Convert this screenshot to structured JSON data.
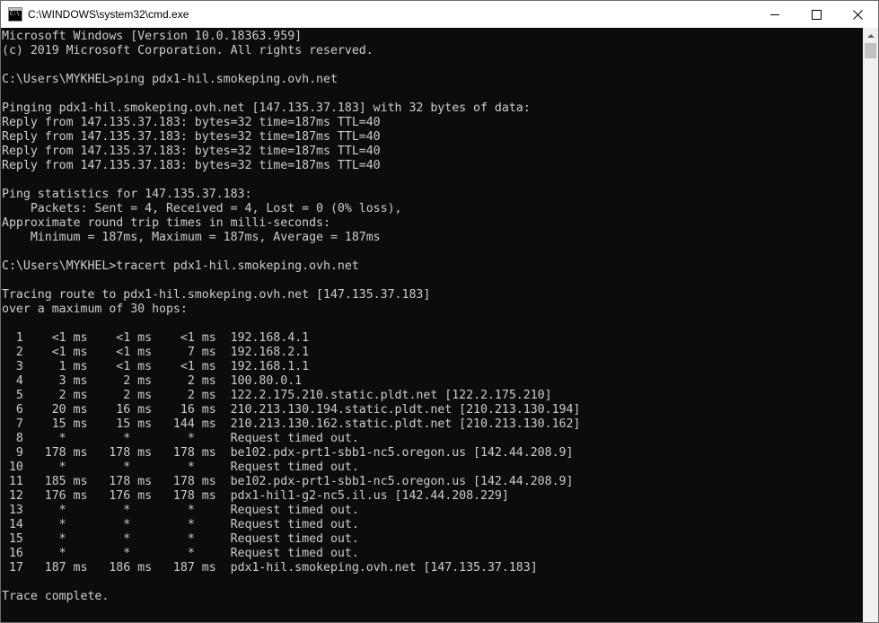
{
  "window": {
    "title": "C:\\WINDOWS\\system32\\cmd.exe",
    "icon": "console-app-icon"
  },
  "controls": {
    "minimize": "minimize-icon",
    "maximize": "maximize-icon",
    "close": "close-icon"
  },
  "console": {
    "lines": [
      "Microsoft Windows [Version 10.0.18363.959]",
      "(c) 2019 Microsoft Corporation. All rights reserved.",
      "",
      "C:\\Users\\MYKHEL>ping pdx1-hil.smokeping.ovh.net",
      "",
      "Pinging pdx1-hil.smokeping.ovh.net [147.135.37.183] with 32 bytes of data:",
      "Reply from 147.135.37.183: bytes=32 time=187ms TTL=40",
      "Reply from 147.135.37.183: bytes=32 time=187ms TTL=40",
      "Reply from 147.135.37.183: bytes=32 time=187ms TTL=40",
      "Reply from 147.135.37.183: bytes=32 time=187ms TTL=40",
      "",
      "Ping statistics for 147.135.37.183:",
      "    Packets: Sent = 4, Received = 4, Lost = 0 (0% loss),",
      "Approximate round trip times in milli-seconds:",
      "    Minimum = 187ms, Maximum = 187ms, Average = 187ms",
      "",
      "C:\\Users\\MYKHEL>tracert pdx1-hil.smokeping.ovh.net",
      "",
      "Tracing route to pdx1-hil.smokeping.ovh.net [147.135.37.183]",
      "over a maximum of 30 hops:",
      "",
      "  1    <1 ms    <1 ms    <1 ms  192.168.4.1",
      "  2    <1 ms    <1 ms     7 ms  192.168.2.1",
      "  3     1 ms    <1 ms    <1 ms  192.168.1.1",
      "  4     3 ms     2 ms     2 ms  100.80.0.1",
      "  5     2 ms     2 ms     2 ms  122.2.175.210.static.pldt.net [122.2.175.210]",
      "  6    20 ms    16 ms    16 ms  210.213.130.194.static.pldt.net [210.213.130.194]",
      "  7    15 ms    15 ms   144 ms  210.213.130.162.static.pldt.net [210.213.130.162]",
      "  8     *        *        *     Request timed out.",
      "  9   178 ms   178 ms   178 ms  be102.pdx-prt1-sbb1-nc5.oregon.us [142.44.208.9]",
      " 10     *        *        *     Request timed out.",
      " 11   185 ms   178 ms   178 ms  be102.pdx-prt1-sbb1-nc5.oregon.us [142.44.208.9]",
      " 12   176 ms   176 ms   178 ms  pdx1-hil1-g2-nc5.il.us [142.44.208.229]",
      " 13     *        *        *     Request timed out.",
      " 14     *        *        *     Request timed out.",
      " 15     *        *        *     Request timed out.",
      " 16     *        *        *     Request timed out.",
      " 17   187 ms   186 ms   187 ms  pdx1-hil.smokeping.ovh.net [147.135.37.183]",
      "",
      "Trace complete."
    ]
  },
  "colors": {
    "console_bg": "#0c0c0c",
    "console_fg": "#cccccc",
    "titlebar_bg": "#ffffff"
  }
}
